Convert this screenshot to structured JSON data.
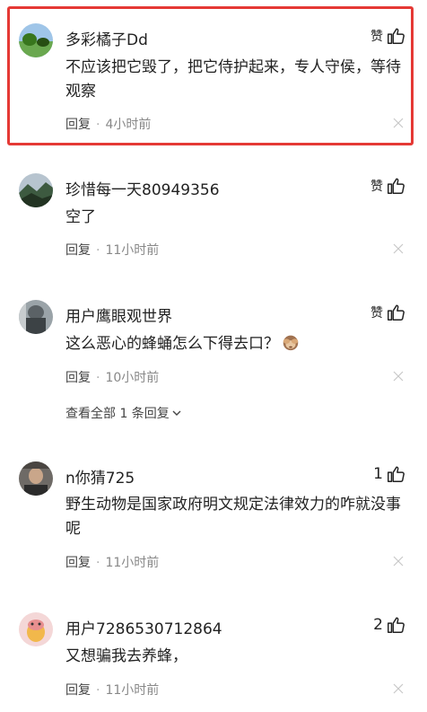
{
  "comments": [
    {
      "username": "多彩橘子Dd",
      "like_label": "赞",
      "text": "不应该把它毁了，把它侍护起来，专人守侯，等待观察",
      "reply_label": "回复",
      "time": "4小时前"
    },
    {
      "username": "珍惜每一天80949356",
      "like_label": "赞",
      "text": "空了",
      "reply_label": "回复",
      "time": "11小时前"
    },
    {
      "username": "用户鹰眼观世界",
      "like_label": "赞",
      "text": "这么恶心的蜂蛹怎么下得去口？",
      "emoji": "see-no-evil-monkey",
      "reply_label": "回复",
      "time": "10小时前",
      "view_replies": "查看全部 1 条回复"
    },
    {
      "username": "n你猜725",
      "like_count": "1",
      "text": "野生动物是国家政府明文规定法律效力的咋就没事呢",
      "reply_label": "回复",
      "time": "11小时前"
    },
    {
      "username": "用户7286530712864",
      "like_count": "2",
      "text": "又想骗我去养蜂，",
      "reply_label": "回复",
      "time": "11小时前"
    }
  ],
  "separator": "·",
  "colors": {
    "highlight": "#e53935",
    "meta": "#888888"
  }
}
